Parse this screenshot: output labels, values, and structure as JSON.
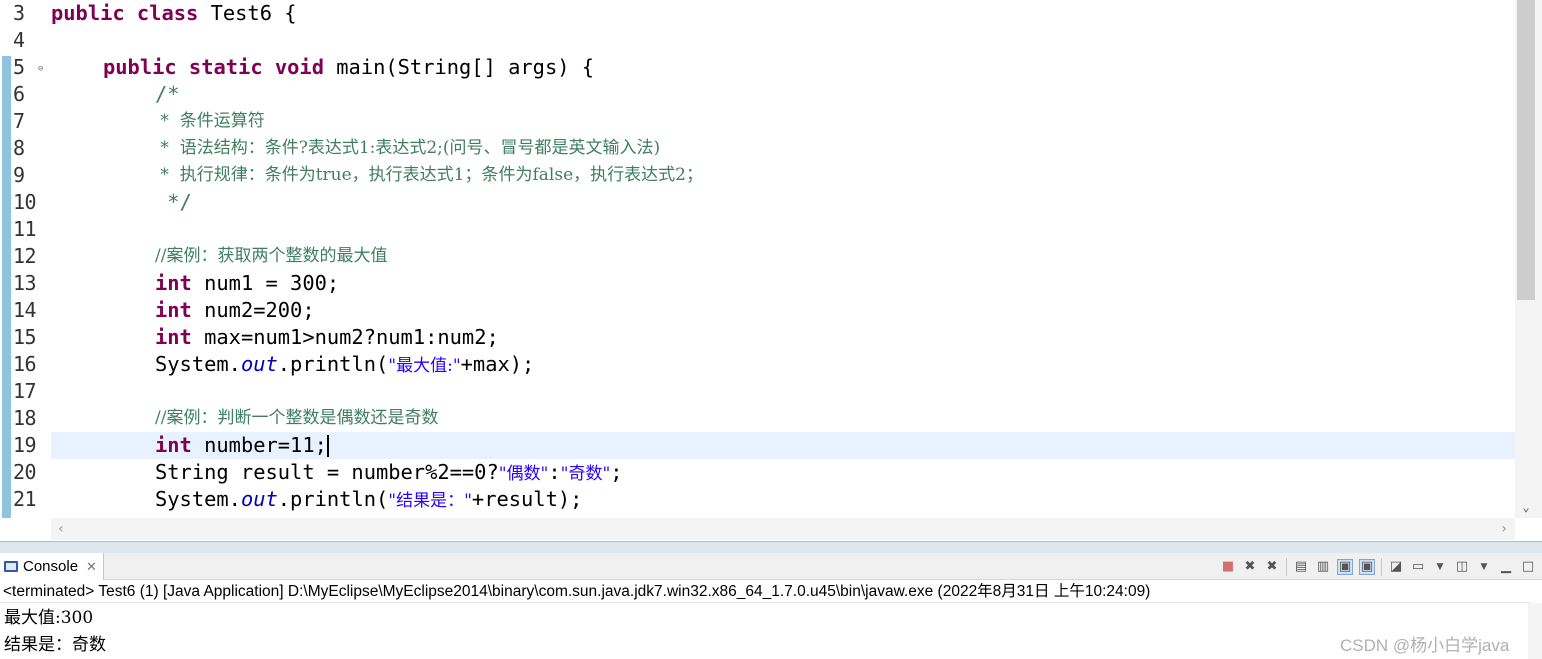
{
  "editor": {
    "line_numbers": [
      "3",
      "4",
      "5",
      "6",
      "7",
      "8",
      "9",
      "10",
      "11",
      "12",
      "13",
      "14",
      "15",
      "16",
      "17",
      "18",
      "19",
      "20",
      "21"
    ],
    "line3": {
      "kw": "public class",
      "rest": " Test6 {"
    },
    "line5": {
      "kw": "public static void",
      "rest": " main(String[] args) {"
    },
    "line6": "/*",
    "line7": " *  条件运算符",
    "line8": " *  语法结构：条件?表达式1:表达式2;(问号、冒号都是英文输入法)",
    "line9": " *  执行规律：条件为true，执行表达式1；条件为false，执行表达式2；",
    "line10": " */",
    "line12": "//案例：获取两个整数的最大值",
    "line13": {
      "kw": "int",
      "rest": " num1 = 300;"
    },
    "line14": {
      "kw": "int",
      "rest": " num2=200;"
    },
    "line15": {
      "kw": "int",
      "rest": " max=num1>num2?num1:num2;"
    },
    "line16": {
      "a": "System.",
      "field": "out",
      "b": ".println(",
      "str": "\"最大值:\"",
      "c": "+max);"
    },
    "line18": "//案例：判断一个整数是偶数还是奇数",
    "line19": {
      "kw": "int",
      "rest": " number=11;"
    },
    "line20": {
      "a": "String result = number%2==0?",
      "s1": "\"偶数\"",
      "colon": ":",
      "s2": "\"奇数\"",
      "end": ";"
    },
    "line21": {
      "a": "System.",
      "field": "out",
      "b": ".println(",
      "str": "\"结果是：\"",
      "c": "+result);"
    }
  },
  "console": {
    "tab_label": "Console",
    "status": "<terminated> Test6 (1) [Java Application] D:\\MyEclipse\\MyEclipse2014\\binary\\com.sun.java.jdk7.win32.x86_64_1.7.0.u45\\bin\\javaw.exe (2022年8月31日 上午10:24:09)",
    "output_lines": [
      "最大值:300",
      "结果是：奇数"
    ]
  },
  "watermark": "CSDN @杨小白学java",
  "colors": {
    "keyword": "#7f0055",
    "comment": "#3f7f5f",
    "string": "#2a00ff",
    "field": "#0000c0",
    "current_line": "#e8f2fe"
  }
}
